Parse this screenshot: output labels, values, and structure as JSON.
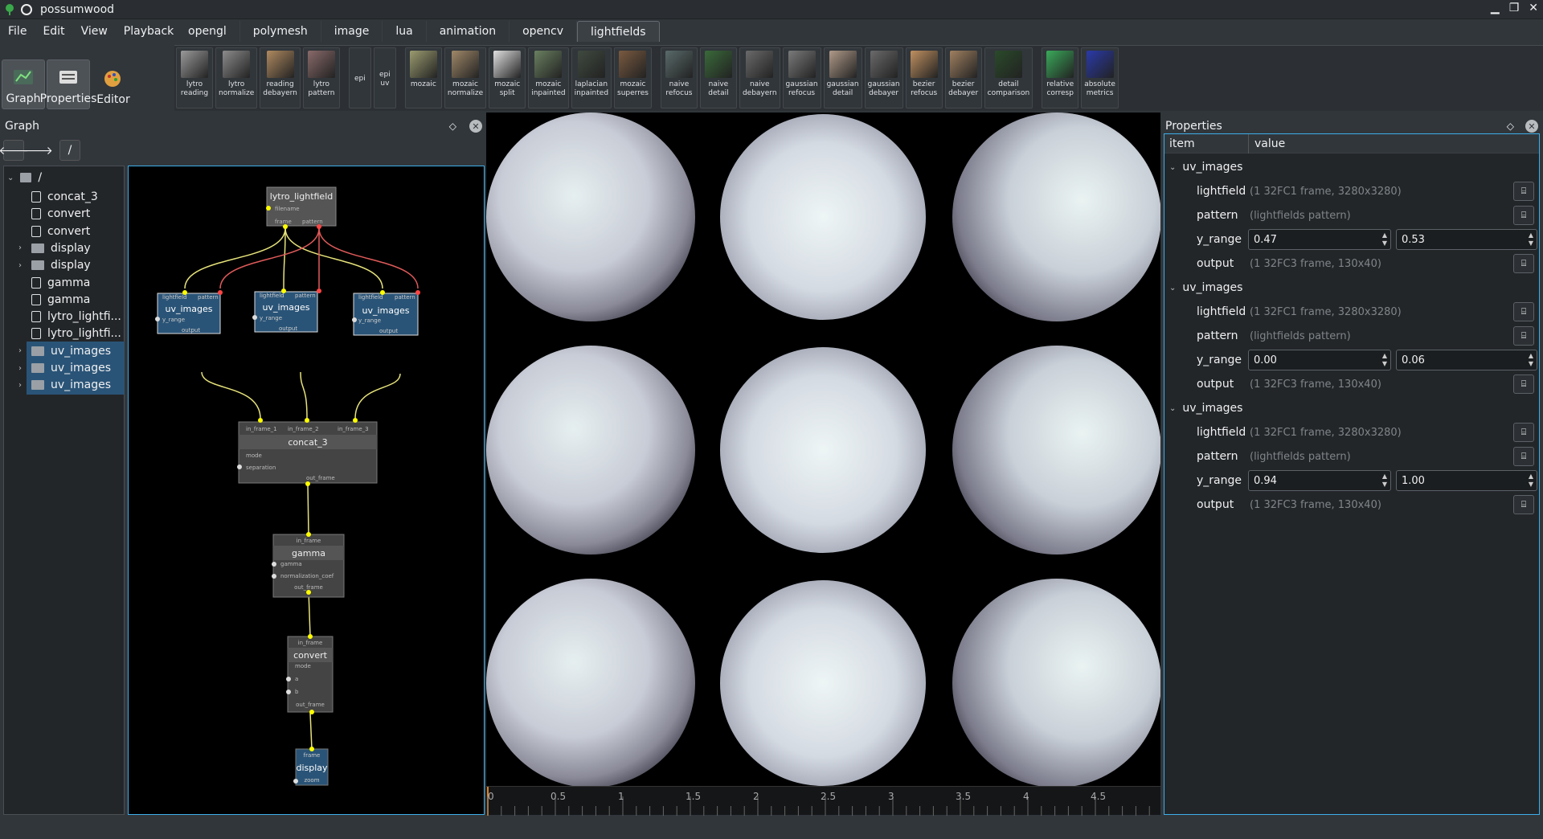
{
  "app": {
    "title": "possumwood"
  },
  "menu": [
    "File",
    "Edit",
    "View",
    "Playback"
  ],
  "tabs": [
    "opengl",
    "polymesh",
    "image",
    "lua",
    "animation",
    "opencv",
    "lightfields"
  ],
  "active_tab": "lightfields",
  "modes": [
    {
      "label": "Graph",
      "icon": "graph-icon"
    },
    {
      "label": "Properties",
      "icon": "properties-icon"
    },
    {
      "label": "Editor",
      "icon": "editor-icon"
    }
  ],
  "toolbar": [
    {
      "label": "lytro\nreading",
      "color": "#9a9a9a"
    },
    {
      "label": "lytro\nnormalize",
      "color": "#8c8c8c"
    },
    {
      "label": "reading\ndebayern",
      "color": "#b08a60"
    },
    {
      "label": "lytro\npattern",
      "color": "#8a6a6a"
    },
    {
      "label": "epi",
      "text": true
    },
    {
      "label": "epi\nuv",
      "text": true
    },
    {
      "label": "mozaic",
      "color": "#9c9c70"
    },
    {
      "label": "mozaic\nnormalize",
      "color": "#a08868"
    },
    {
      "label": "mozaic\nsplit",
      "color": "#e0e0e0"
    },
    {
      "label": "mozaic\ninpainted",
      "color": "#6a8060"
    },
    {
      "label": "laplacian\ninpainted",
      "color": "#404a40"
    },
    {
      "label": "mozaic\nsuperres",
      "color": "#7a5a40"
    },
    {
      "label": "naive\nrefocus",
      "color": "#5a6a6a"
    },
    {
      "label": "naive\ndetail",
      "color": "#3a6a3a"
    },
    {
      "label": "naive\ndebayern",
      "color": "#6a6a6a"
    },
    {
      "label": "gaussian\nrefocus",
      "color": "#7a7a7a"
    },
    {
      "label": "gaussian\ndetail",
      "color": "#b09a88"
    },
    {
      "label": "gaussian\ndebayer",
      "color": "#6a6a6a"
    },
    {
      "label": "bezier\nrefocus",
      "color": "#c09060"
    },
    {
      "label": "bezier\ndebayer",
      "color": "#a08060"
    },
    {
      "label": "detail\ncomparison",
      "color": "#2a4a2a"
    },
    {
      "label": "relative\ncorresp",
      "color": "#3aaa5a"
    },
    {
      "label": "absolute\nmetrics",
      "color": "#2a3aaa"
    }
  ],
  "graph_panel": {
    "title": "Graph",
    "path": "/"
  },
  "tree": {
    "root": "/",
    "items": [
      {
        "label": "concat_3",
        "type": "node",
        "selected": false,
        "expandable": false
      },
      {
        "label": "convert",
        "type": "node",
        "selected": false,
        "expandable": false
      },
      {
        "label": "convert",
        "type": "node",
        "selected": false,
        "expandable": false
      },
      {
        "label": "display",
        "type": "folder",
        "selected": false,
        "expandable": true
      },
      {
        "label": "display",
        "type": "folder",
        "selected": false,
        "expandable": true
      },
      {
        "label": "gamma",
        "type": "node",
        "selected": false,
        "expandable": false
      },
      {
        "label": "gamma",
        "type": "node",
        "selected": false,
        "expandable": false
      },
      {
        "label": "lytro_lightfi...",
        "type": "node",
        "selected": false,
        "expandable": false
      },
      {
        "label": "lytro_lightfi...",
        "type": "node",
        "selected": false,
        "expandable": false
      },
      {
        "label": "uv_images",
        "type": "folder",
        "selected": true,
        "expandable": true
      },
      {
        "label": "uv_images",
        "type": "folder",
        "selected": true,
        "expandable": true
      },
      {
        "label": "uv_images",
        "type": "folder",
        "selected": true,
        "expandable": true
      }
    ]
  },
  "nodes": {
    "lytro": {
      "title": "lytro_lightfield",
      "ports": [
        "filename",
        "frame",
        "pattern"
      ]
    },
    "uv": {
      "title": "uv_images",
      "ports": [
        "lightfield",
        "pattern",
        "y_range",
        "output"
      ]
    },
    "concat": {
      "title": "concat_3",
      "ports": [
        "in_frame_1",
        "in_frame_2",
        "in_frame_3",
        "mode",
        "separation",
        "out_frame"
      ]
    },
    "gamma": {
      "title": "gamma",
      "ports": [
        "in_frame",
        "gamma",
        "normalization_coef",
        "out_frame"
      ]
    },
    "convert": {
      "title": "convert",
      "ports": [
        "in_frame",
        "mode",
        "a",
        "b",
        "out_frame"
      ]
    },
    "display": {
      "title": "display",
      "ports": [
        "frame",
        "zoom"
      ]
    }
  },
  "ruler": [
    "0",
    "0.5",
    "1",
    "1.5",
    "2",
    "2.5",
    "3",
    "3.5",
    "4",
    "4.5"
  ],
  "properties": {
    "title": "Properties",
    "col_item": "item",
    "col_value": "value",
    "groups": [
      {
        "name": "uv_images",
        "lightfield": "(1 32FC1 frame, 3280x3280)",
        "pattern": "(lightfields pattern)",
        "y_min": "0.47",
        "y_max": "0.53",
        "output": "(1 32FC3 frame, 130x40)"
      },
      {
        "name": "uv_images",
        "lightfield": "(1 32FC1 frame, 3280x3280)",
        "pattern": "(lightfields pattern)",
        "y_min": "0.00",
        "y_max": "0.06",
        "output": "(1 32FC3 frame, 130x40)"
      },
      {
        "name": "uv_images",
        "lightfield": "(1 32FC1 frame, 3280x3280)",
        "pattern": "(lightfields pattern)",
        "y_min": "0.94",
        "y_max": "1.00",
        "output": "(1 32FC3 frame, 130x40)"
      }
    ],
    "labels": {
      "lightfield": "lightfield",
      "pattern": "pattern",
      "y_range": "y_range",
      "output": "output"
    }
  }
}
